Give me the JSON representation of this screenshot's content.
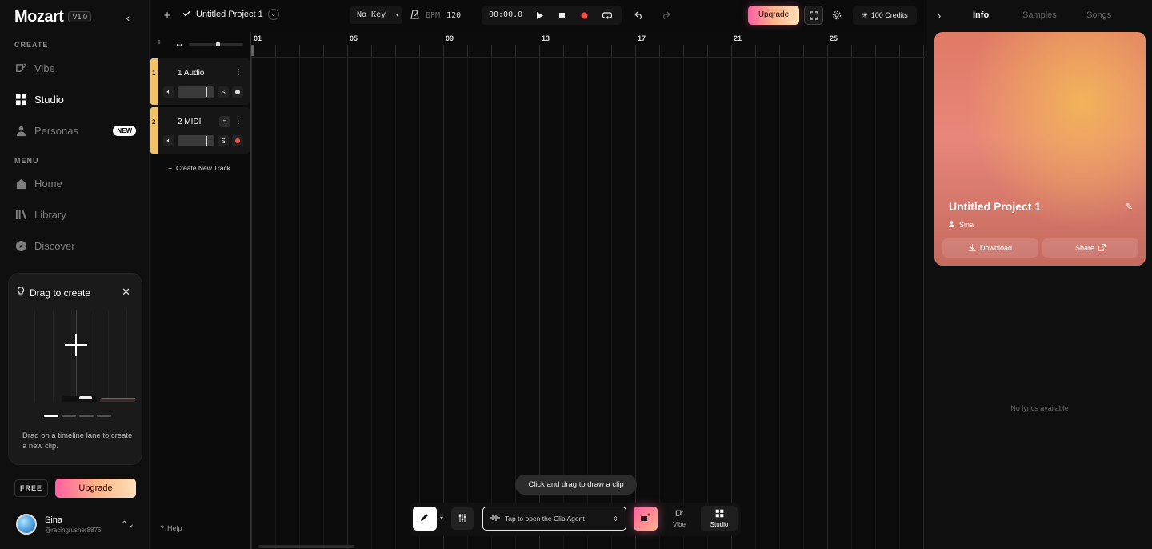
{
  "app": {
    "logo": "Mozart",
    "version": "V1.0"
  },
  "sidebar": {
    "create_label": "CREATE",
    "create_items": [
      {
        "label": "Vibe"
      },
      {
        "label": "Studio"
      },
      {
        "label": "Personas",
        "badge": "NEW"
      }
    ],
    "menu_label": "MENU",
    "menu_items": [
      {
        "label": "Home"
      },
      {
        "label": "Library"
      },
      {
        "label": "Discover"
      }
    ],
    "drag_card": {
      "title": "Drag to create",
      "description": "Drag on a timeline lane to create a new clip."
    },
    "plan": "FREE",
    "upgrade_label": "Upgrade",
    "user": {
      "name": "Sina",
      "handle": "@racingrusher8876"
    }
  },
  "topbar": {
    "project_title": "Untitled Project 1",
    "key": "No Key",
    "bpm_label": "BPM",
    "bpm_value": "120",
    "time": "00:00.0",
    "upgrade_label": "Upgrade",
    "credits": "100 Credits"
  },
  "tracks": {
    "items": [
      {
        "number": "1",
        "name": "1 Audio",
        "solo": "S"
      },
      {
        "number": "2",
        "name": "2 MIDI",
        "solo": "S"
      }
    ],
    "create_label": "Create New Track"
  },
  "timeline": {
    "bar_labels": [
      "01",
      "05",
      "09",
      "13",
      "17",
      "21",
      "25"
    ],
    "hint": "Click and drag to draw a clip"
  },
  "bottom_bar": {
    "agent_placeholder": "Tap to open the Clip Agent",
    "modes": [
      {
        "label": "Vibe"
      },
      {
        "label": "Studio"
      }
    ]
  },
  "help_label": "Help",
  "right_panel": {
    "tabs": [
      {
        "label": "Info"
      },
      {
        "label": "Samples"
      },
      {
        "label": "Songs"
      }
    ],
    "cover": {
      "title": "Untitled Project 1",
      "owner": "Sina",
      "download_label": "Download",
      "share_label": "Share"
    },
    "no_lyrics": "No lyrics available"
  },
  "colors": {
    "accent_gradient_start": "#ff5fa2",
    "accent_gradient_end": "#ffe0b8",
    "track_stripe": "#f2c26a",
    "record_red": "#ff4a4a"
  }
}
